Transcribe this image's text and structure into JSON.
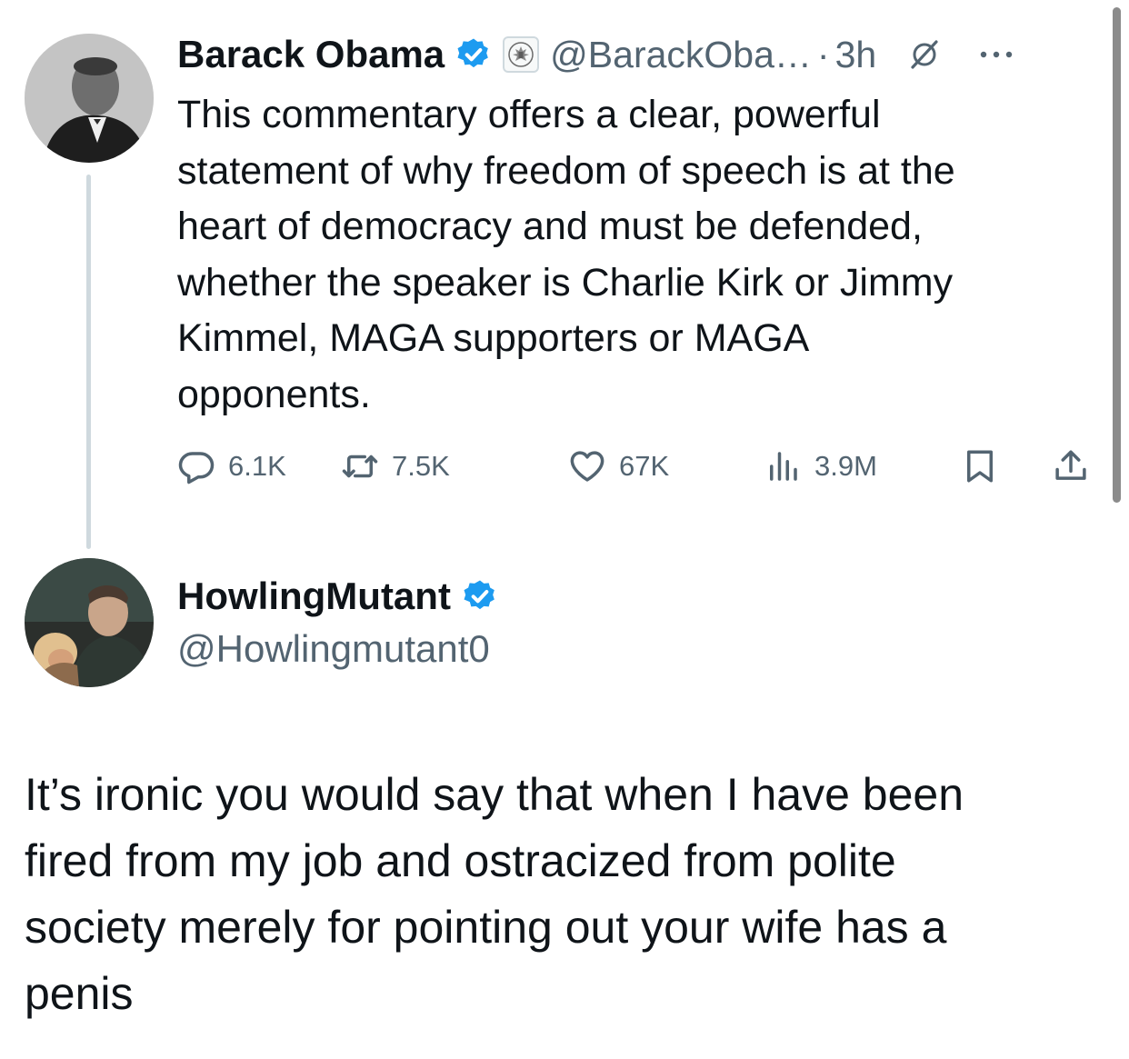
{
  "original_tweet": {
    "author_name": "Barack Obama",
    "handle": "@BarackOba…",
    "separator": "·",
    "time": "3h",
    "verified": true,
    "text": "This commentary offers a clear, powerful\nstatement of why freedom of speech is at the\nheart of democracy and must be defended,\nwhether the speaker is Charlie Kirk or Jimmy\nKimmel, MAGA supporters or MAGA\nopponents.",
    "metrics": {
      "replies": "6.1K",
      "reposts": "7.5K",
      "likes": "67K",
      "views": "3.9M"
    },
    "icons": {
      "verified": "verified-badge-icon",
      "affiliation": "government-seal-icon",
      "grok": "grok-slash-icon",
      "more": "more-dots-icon",
      "reply": "reply-bubble-icon",
      "repost": "repost-arrows-icon",
      "like": "heart-icon",
      "views": "views-bar-chart-icon",
      "bookmark": "bookmark-icon",
      "share": "share-upload-icon"
    }
  },
  "reply": {
    "author_name": "HowlingMutant",
    "handle": "@Howlingmutant0",
    "verified": true,
    "text": "It’s ironic you would say that when I have been\nfired from my job and ostracized from polite\nsociety merely for pointing out your wife has a\npenis"
  },
  "colors": {
    "text": "#0f1419",
    "secondary": "#536471",
    "verified_blue": "#1d9bf0",
    "thread_line": "#cfd9de"
  }
}
